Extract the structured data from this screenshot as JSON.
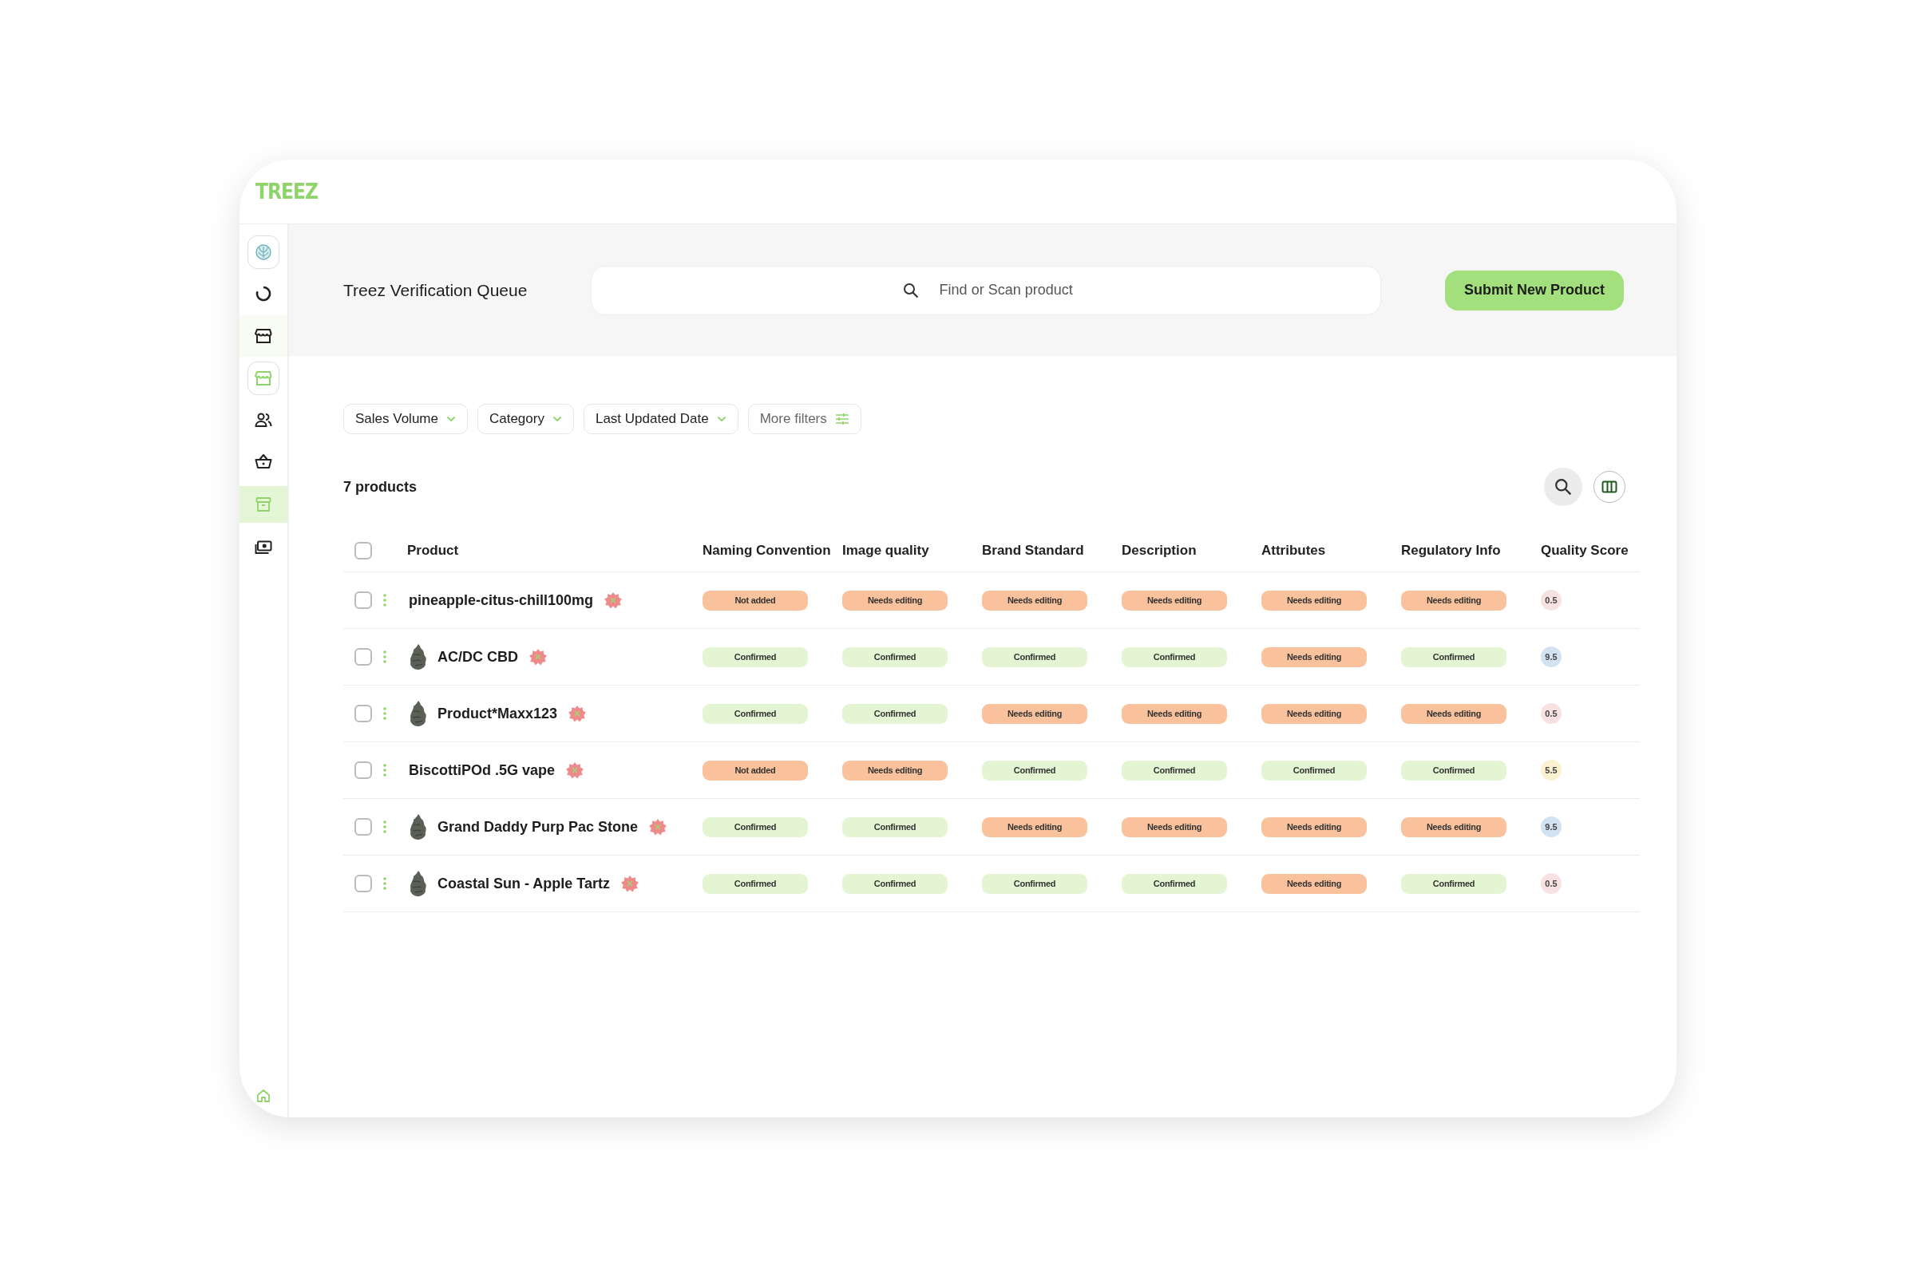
{
  "logo": "TREEZ",
  "sidebar": {
    "items": [
      {
        "kind": "globe",
        "selected": false
      },
      {
        "kind": "ring",
        "selected": false
      },
      {
        "kind": "shop",
        "selected": false
      },
      {
        "kind": "storefront",
        "selected": false
      },
      {
        "kind": "people",
        "selected": false
      },
      {
        "kind": "basket",
        "selected": false
      },
      {
        "kind": "archive",
        "selected": true
      },
      {
        "kind": "cash",
        "selected": false
      }
    ],
    "bottom": {
      "kind": "home"
    }
  },
  "header": {
    "title": "Treez Verification Queue",
    "search": {
      "placeholder": "Find or Scan product"
    },
    "submit_button": "Submit New Product"
  },
  "filters": [
    {
      "label": "Sales Volume",
      "kind": "dropdown"
    },
    {
      "label": "Category",
      "kind": "dropdown"
    },
    {
      "label": "Last Updated Date",
      "kind": "dropdown"
    },
    {
      "label": "More filters",
      "kind": "more"
    }
  ],
  "count": "7 products",
  "table": {
    "columns": [
      "Product",
      "Naming Convention",
      "Image quality",
      "Brand Standard",
      "Description",
      "Attributes",
      "Regulatory Info",
      "Quality Score"
    ],
    "all_checked": false,
    "rows": [
      {
        "checked": false,
        "has_image": false,
        "cells": [
          {
            "text": "pineapple-citus-chill100mg",
            "kind": "product"
          },
          {
            "text": "Not added",
            "kind": "warn"
          },
          {
            "text": "Needs editing",
            "kind": "warn"
          },
          {
            "text": "Needs editing",
            "kind": "warn"
          },
          {
            "text": "Needs editing",
            "kind": "warn"
          },
          {
            "text": "Needs editing",
            "kind": "warn"
          },
          {
            "text": "Needs editing",
            "kind": "warn"
          },
          {
            "text": "0.5",
            "kind": "score",
            "color": "#f8e1e1"
          }
        ]
      },
      {
        "checked": false,
        "has_image": true,
        "cells": [
          {
            "text": "AC/DC CBD",
            "kind": "product"
          },
          {
            "text": "Confirmed",
            "kind": "ok"
          },
          {
            "text": "Confirmed",
            "kind": "ok"
          },
          {
            "text": "Confirmed",
            "kind": "ok"
          },
          {
            "text": "Confirmed",
            "kind": "ok"
          },
          {
            "text": "Needs editing",
            "kind": "warn"
          },
          {
            "text": "Confirmed",
            "kind": "ok"
          },
          {
            "text": "9.5",
            "kind": "score",
            "color": "#d3e2f2"
          }
        ]
      },
      {
        "checked": false,
        "has_image": true,
        "cells": [
          {
            "text": "Product*Maxx123",
            "kind": "product"
          },
          {
            "text": "Confirmed",
            "kind": "ok"
          },
          {
            "text": "Confirmed",
            "kind": "ok"
          },
          {
            "text": "Needs editing",
            "kind": "warn"
          },
          {
            "text": "Needs editing",
            "kind": "warn"
          },
          {
            "text": "Needs editing",
            "kind": "warn"
          },
          {
            "text": "Needs editing",
            "kind": "warn"
          },
          {
            "text": "0.5",
            "kind": "score",
            "color": "#f8e1e1"
          }
        ]
      },
      {
        "checked": false,
        "has_image": false,
        "cells": [
          {
            "text": "BiscottiPOd .5G vape",
            "kind": "product"
          },
          {
            "text": "Not added",
            "kind": "warn"
          },
          {
            "text": "Needs editing",
            "kind": "warn"
          },
          {
            "text": "Confirmed",
            "kind": "ok"
          },
          {
            "text": "Confirmed",
            "kind": "ok"
          },
          {
            "text": "Confirmed",
            "kind": "ok"
          },
          {
            "text": "Confirmed",
            "kind": "ok"
          },
          {
            "text": "5.5",
            "kind": "score",
            "color": "#fbf0d0"
          }
        ]
      },
      {
        "checked": false,
        "has_image": true,
        "cells": [
          {
            "text": "Grand Daddy Purp Pac Stone",
            "kind": "product"
          },
          {
            "text": "Confirmed",
            "kind": "ok"
          },
          {
            "text": "Confirmed",
            "kind": "ok"
          },
          {
            "text": "Needs editing",
            "kind": "warn"
          },
          {
            "text": "Needs editing",
            "kind": "warn"
          },
          {
            "text": "Needs editing",
            "kind": "warn"
          },
          {
            "text": "Needs editing",
            "kind": "warn"
          },
          {
            "text": "9.5",
            "kind": "score",
            "color": "#d3e2f2"
          }
        ]
      },
      {
        "checked": false,
        "has_image": true,
        "cells": [
          {
            "text": "Coastal Sun - Apple Tartz",
            "kind": "product"
          },
          {
            "text": "Confirmed",
            "kind": "ok"
          },
          {
            "text": "Confirmed",
            "kind": "ok"
          },
          {
            "text": "Confirmed",
            "kind": "ok"
          },
          {
            "text": "Confirmed",
            "kind": "ok"
          },
          {
            "text": "Needs editing",
            "kind": "warn"
          },
          {
            "text": "Confirmed",
            "kind": "ok"
          },
          {
            "text": "0.5",
            "kind": "score",
            "color": "#f8e1e1"
          }
        ]
      }
    ]
  }
}
